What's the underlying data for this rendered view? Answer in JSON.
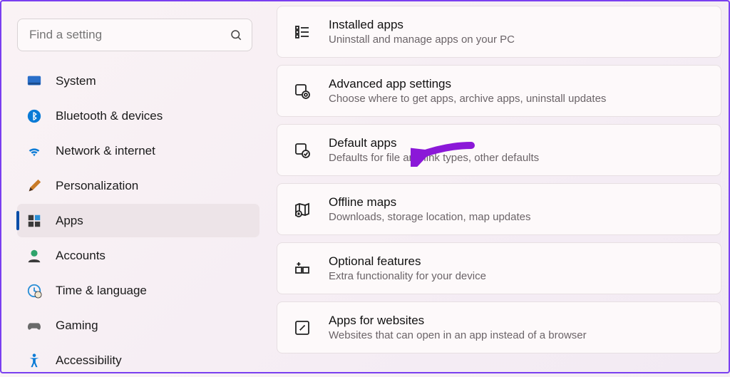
{
  "search": {
    "placeholder": "Find a setting"
  },
  "sidebar": {
    "items": [
      {
        "label": "System"
      },
      {
        "label": "Bluetooth & devices"
      },
      {
        "label": "Network & internet"
      },
      {
        "label": "Personalization"
      },
      {
        "label": "Apps"
      },
      {
        "label": "Accounts"
      },
      {
        "label": "Time & language"
      },
      {
        "label": "Gaming"
      },
      {
        "label": "Accessibility"
      }
    ]
  },
  "main": {
    "cards": [
      {
        "title": "Installed apps",
        "desc": "Uninstall and manage apps on your PC"
      },
      {
        "title": "Advanced app settings",
        "desc": "Choose where to get apps, archive apps, uninstall updates"
      },
      {
        "title": "Default apps",
        "desc": "Defaults for file and link types, other defaults"
      },
      {
        "title": "Offline maps",
        "desc": "Downloads, storage location, map updates"
      },
      {
        "title": "Optional features",
        "desc": "Extra functionality for your device"
      },
      {
        "title": "Apps for websites",
        "desc": "Websites that can open in an app instead of a browser"
      }
    ]
  }
}
